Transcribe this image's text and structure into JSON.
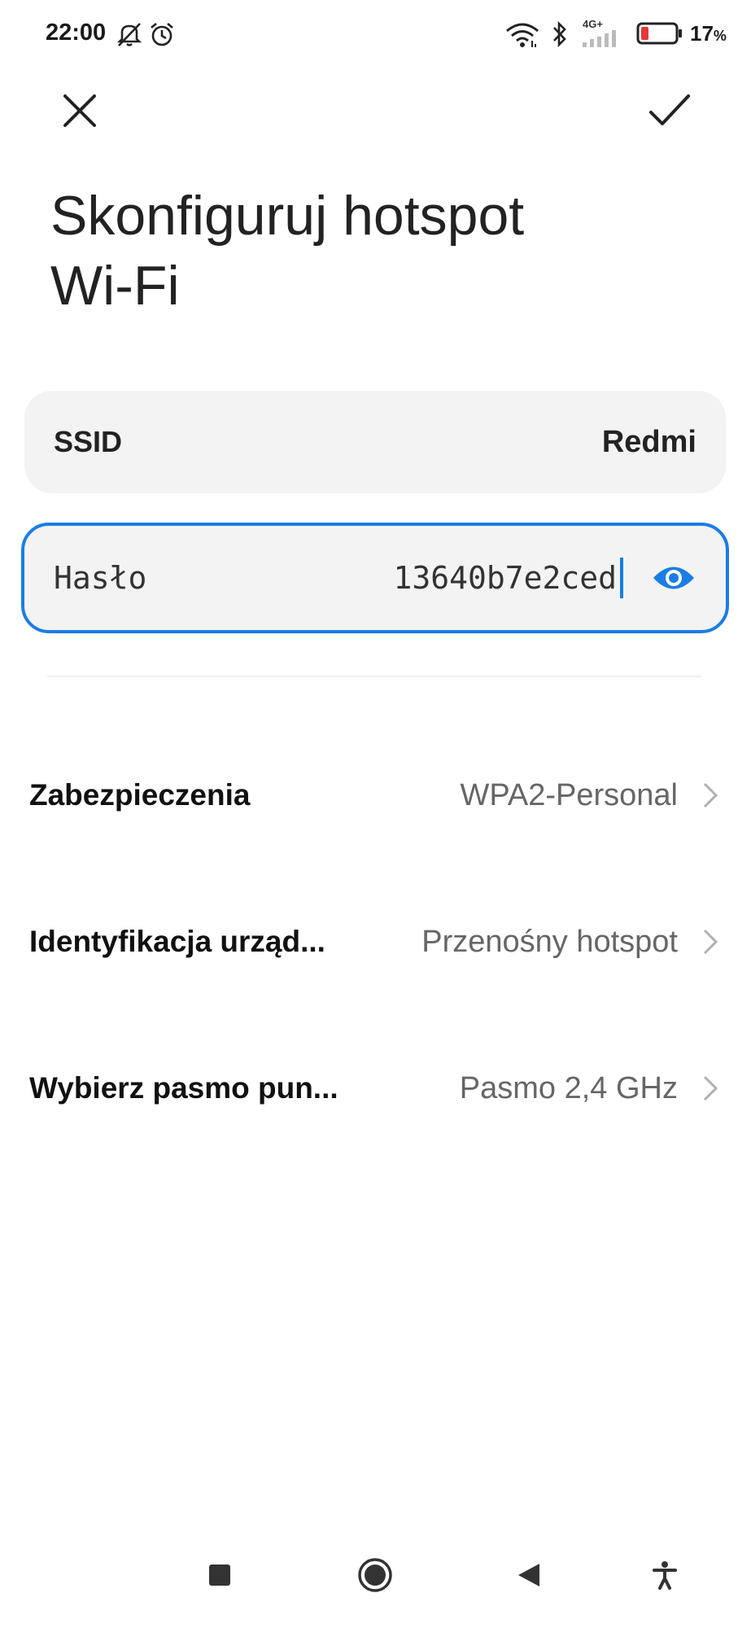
{
  "status_bar": {
    "time": "22:00",
    "battery_percent": "17",
    "battery_unit": "%",
    "network_label": "4G+",
    "icons": [
      "mute-icon",
      "alarm-icon",
      "wifi-icon",
      "bluetooth-icon",
      "signal-icon",
      "battery-icon"
    ],
    "battery_color": "#e53935"
  },
  "header": {
    "close_icon": "close-icon",
    "confirm_icon": "check-icon"
  },
  "title": {
    "line1": "Skonfiguruj hotspot",
    "line2": "Wi-Fi"
  },
  "ssid": {
    "label": "SSID",
    "value": "Redmi"
  },
  "password": {
    "label": "Hasło",
    "value": "13640b7e2ced",
    "visibility_icon": "eye-icon",
    "accent_color": "#1a7de3"
  },
  "settings": [
    {
      "label": "Zabezpieczenia",
      "value": "WPA2-Personal"
    },
    {
      "label": "Identyfikacja urząd...",
      "value": "Przenośny hotspot"
    },
    {
      "label": "Wybierz pasmo pun...",
      "value": "Pasmo 2,4 GHz"
    }
  ],
  "nav": {
    "icons": [
      "recents-icon",
      "home-icon",
      "back-icon",
      "accessibility-icon"
    ]
  }
}
